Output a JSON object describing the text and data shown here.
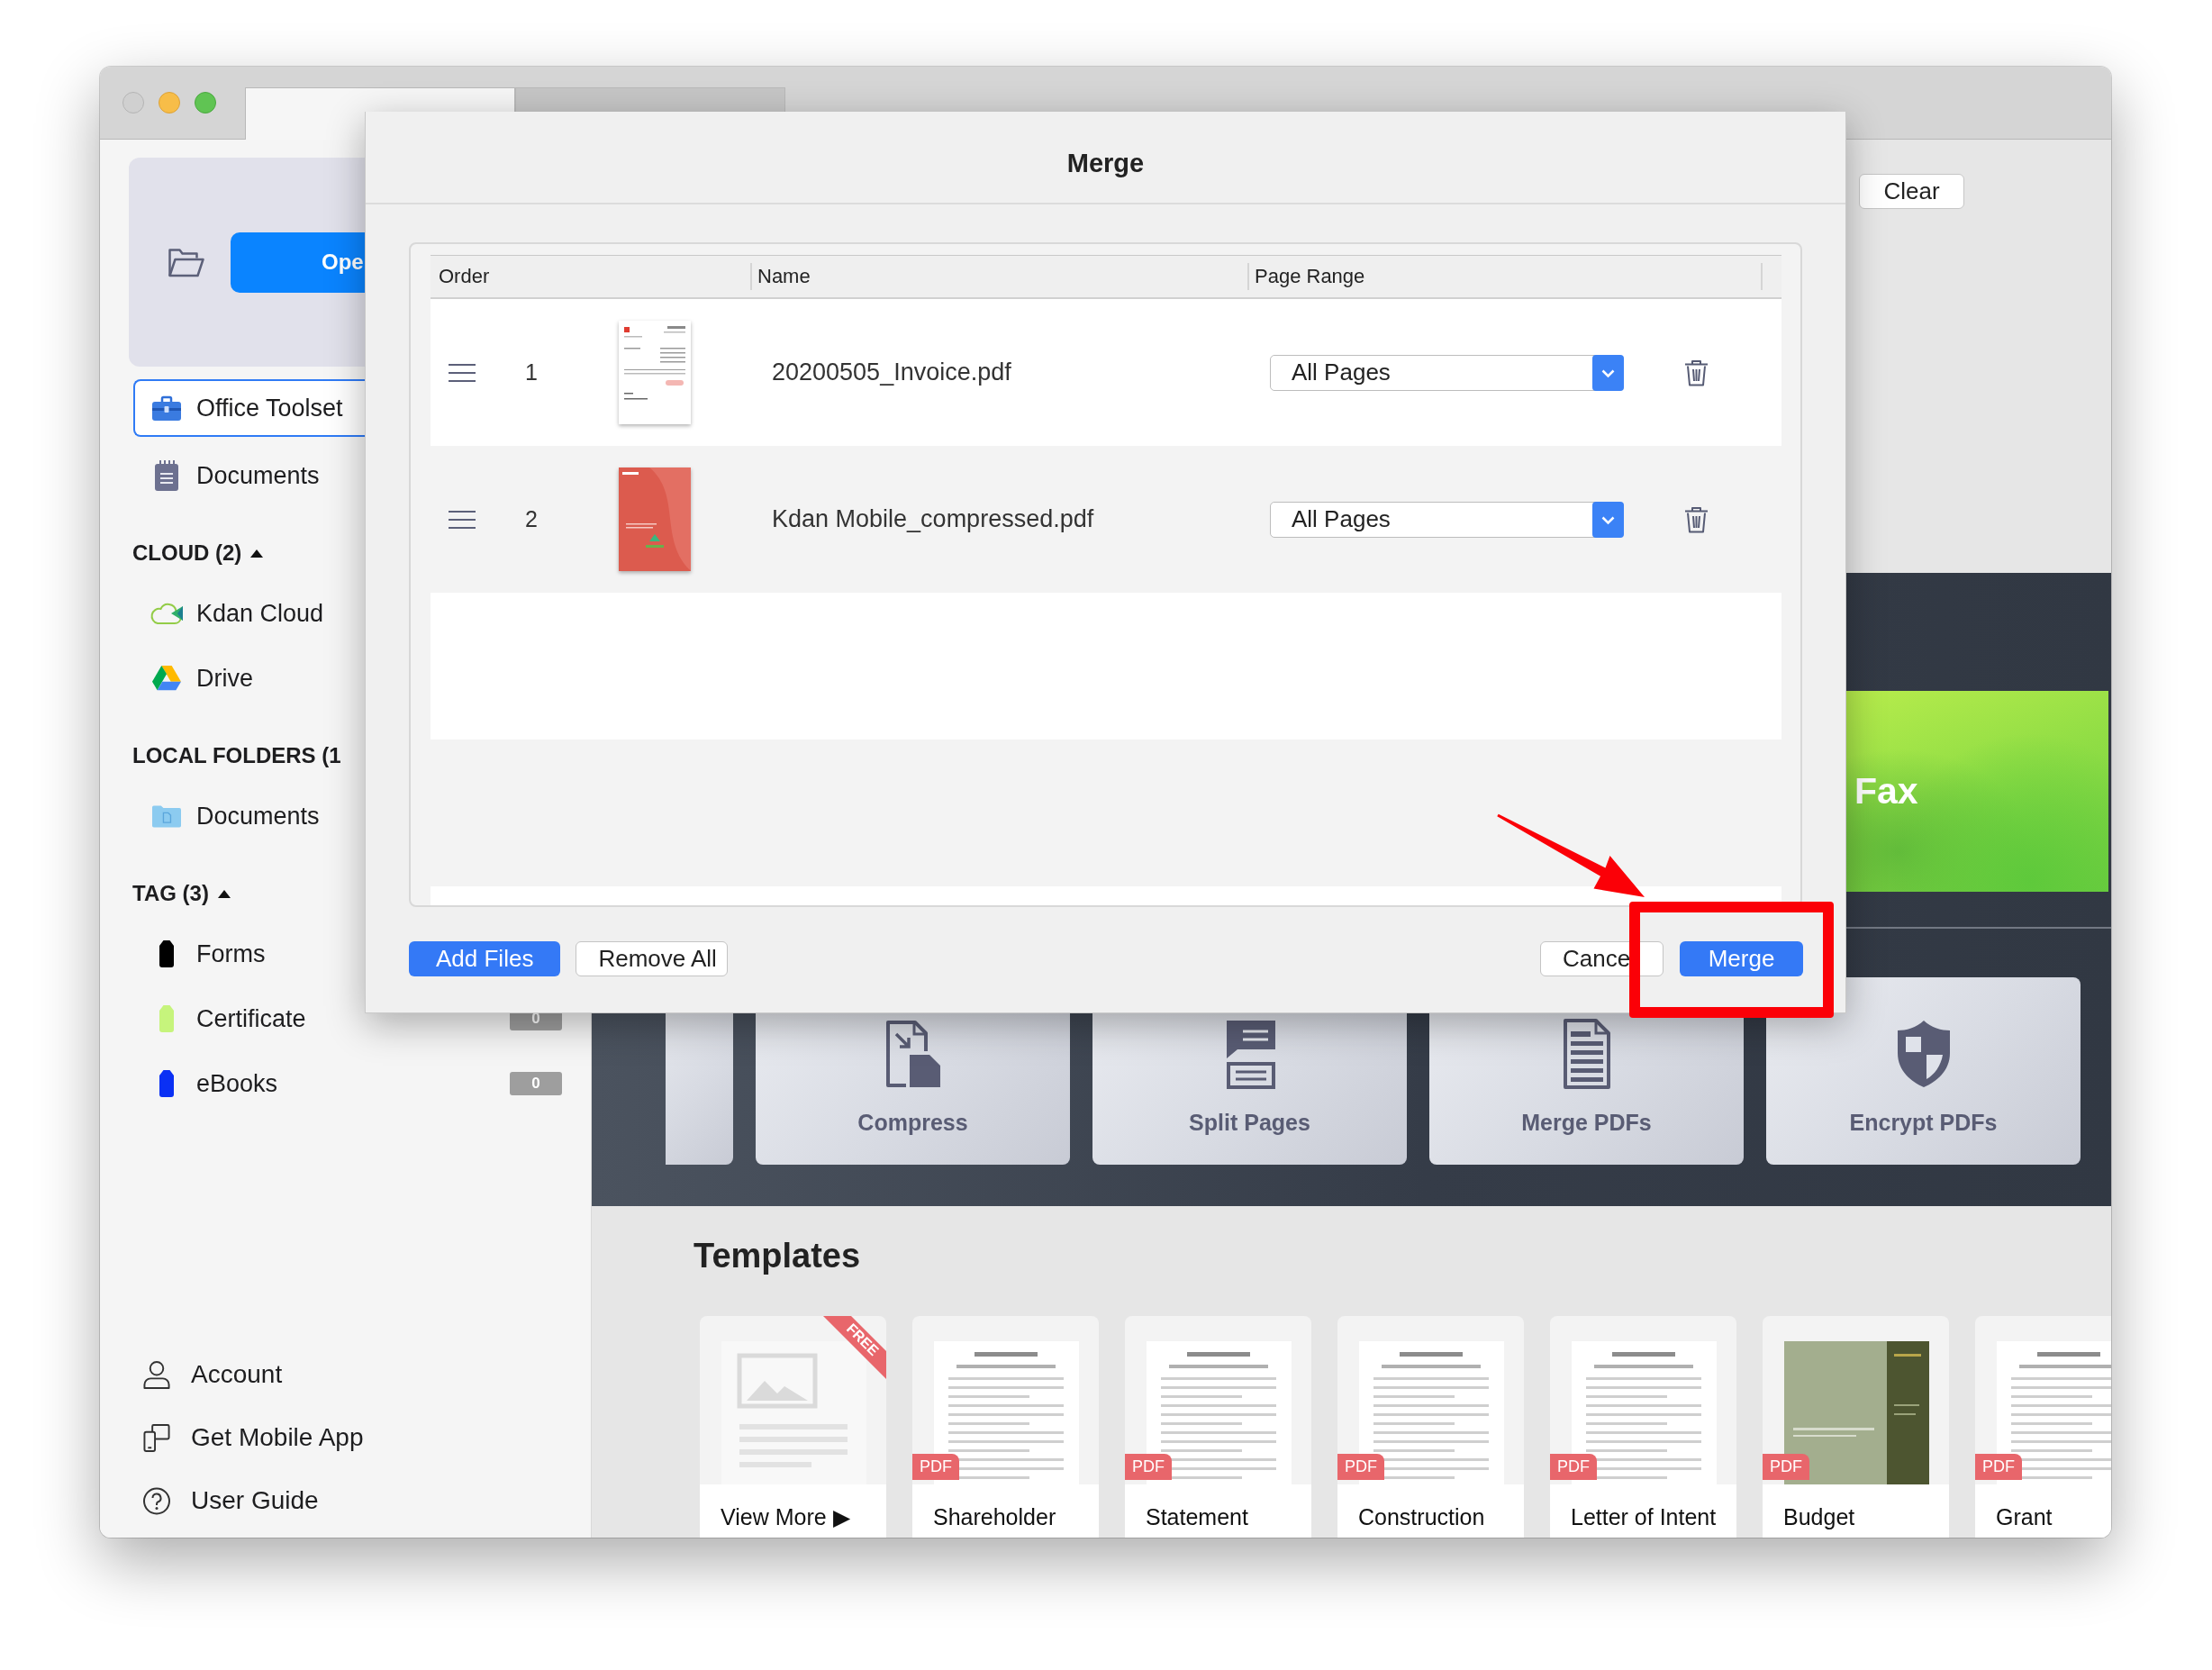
{
  "window": {
    "tabs": [
      {
        "selected": true
      },
      {
        "selected": false
      }
    ]
  },
  "sidebar": {
    "open_button": "Ope",
    "nav": [
      {
        "kind": "toolset",
        "label": "Office Toolset",
        "selected": true
      },
      {
        "kind": "documents",
        "label": "Documents",
        "selected": false
      }
    ],
    "sections": [
      {
        "title": "CLOUD (2)",
        "expanded": true,
        "items": [
          {
            "kind": "cloud",
            "label": "Kdan Cloud",
            "selected": false
          },
          {
            "kind": "drive",
            "label": "Drive",
            "selected": false
          }
        ]
      },
      {
        "title": "LOCAL FOLDERS (1",
        "items": [
          {
            "kind": "folder",
            "label": "Documents",
            "selected": false
          }
        ]
      },
      {
        "title": "TAG (3)",
        "expanded": true,
        "items": [
          {
            "kind": "tag",
            "label": "Forms",
            "color": "#000000",
            "selected": false
          },
          {
            "kind": "tag",
            "label": "Certificate",
            "color": "#c6f47c",
            "count": "0",
            "selected": false
          },
          {
            "kind": "tag",
            "label": "eBooks",
            "color": "#0a30f4",
            "count": "0",
            "selected": false
          }
        ]
      }
    ],
    "footer": [
      {
        "kind": "account",
        "label": "Account"
      },
      {
        "kind": "mobile",
        "label": "Get Mobile App"
      },
      {
        "kind": "help",
        "label": "User Guide"
      }
    ]
  },
  "main": {
    "clear_button": "Clear",
    "banner": {
      "title": "Fax"
    },
    "tools": [
      {
        "kind": "partial"
      },
      {
        "kind": "compress",
        "label": "Compress"
      },
      {
        "kind": "split",
        "label": "Split Pages"
      },
      {
        "kind": "merge",
        "label": "Merge PDFs"
      },
      {
        "kind": "encrypt",
        "label": "Encrypt PDFs"
      }
    ],
    "templates": {
      "title": "Templates",
      "items": [
        {
          "kind": "more",
          "title": "View More ▶",
          "ribbon": "FREE"
        },
        {
          "kind": "document",
          "title": "Shareholder",
          "badge": "PDF"
        },
        {
          "kind": "document",
          "title": "Statement",
          "badge": "PDF"
        },
        {
          "kind": "document",
          "title": "Construction",
          "badge": "PDF"
        },
        {
          "kind": "document",
          "title": "Letter of Intent",
          "badge": "PDF"
        },
        {
          "kind": "cover",
          "title": "Budget",
          "badge": "PDF"
        },
        {
          "kind": "document",
          "title": "Grant",
          "badge": "PDF"
        }
      ]
    }
  },
  "dialog": {
    "title": "Merge",
    "columns": [
      "Order",
      "Name",
      "Page Range"
    ],
    "files": [
      {
        "kind": "page",
        "order": "1",
        "name": "20200505_Invoice.pdf",
        "range": "All Pages"
      },
      {
        "kind": "cover",
        "order": "2",
        "name": "Kdan Mobile_compressed.pdf",
        "range": "All Pages"
      }
    ],
    "left_buttons": [
      {
        "kind": "primary",
        "label": "Add Files"
      },
      {
        "kind": "secondary",
        "label": "Remove All"
      }
    ],
    "right_buttons": [
      {
        "kind": "secondary",
        "label": "Cance"
      },
      {
        "kind": "primary",
        "label": "Merge"
      }
    ]
  }
}
